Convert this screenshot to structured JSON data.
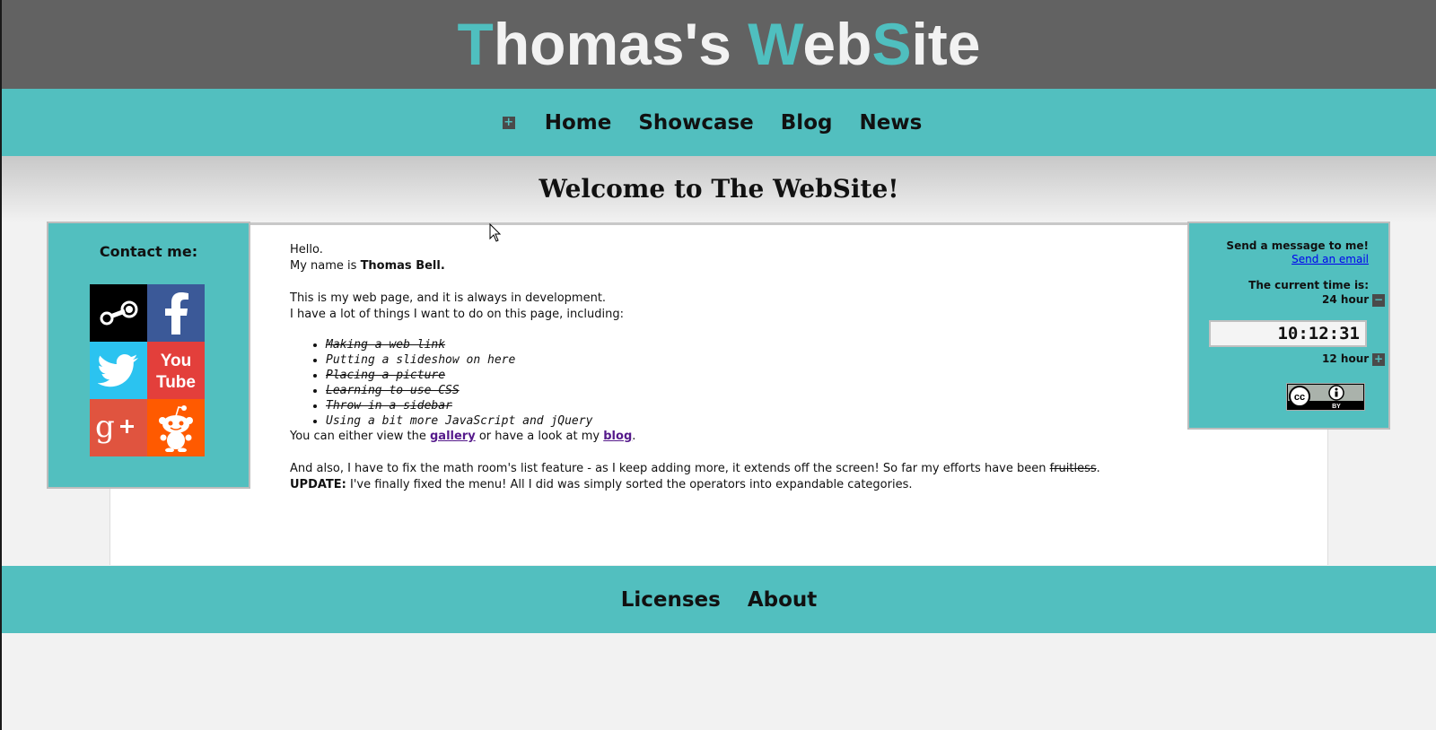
{
  "header": {
    "title_parts": [
      {
        "text": "T",
        "accent": true
      },
      {
        "text": "homas's ",
        "accent": false
      },
      {
        "text": "W",
        "accent": true
      },
      {
        "text": "eb",
        "accent": false
      },
      {
        "text": "S",
        "accent": true
      },
      {
        "text": "ite",
        "accent": false
      }
    ]
  },
  "nav": {
    "toggle_glyph": "+",
    "items": [
      "Home",
      "Showcase",
      "Blog",
      "News"
    ]
  },
  "welcome": {
    "title": "Welcome to The WebSite!"
  },
  "contact": {
    "title": "Contact me:",
    "icons": [
      "steam-icon",
      "facebook-icon",
      "twitter-icon",
      "youtube-icon",
      "google-plus-icon",
      "reddit-icon"
    ]
  },
  "content": {
    "hello": "Hello.",
    "name_prefix": "My name is ",
    "name": "Thomas Bell.",
    "intro1": "This is my web page, and it is always in development.",
    "intro2": "I have a lot of things I want to do on this page, including:",
    "todos": [
      {
        "text": "Making a web link",
        "done": true
      },
      {
        "text": "Putting a slideshow on here",
        "done": false
      },
      {
        "text": "Placing a picture",
        "done": true
      },
      {
        "text": "Learning to use CSS",
        "done": true
      },
      {
        "text": "Throw in a sidebar",
        "done": true
      },
      {
        "text": "Using a bit more JavaScript and jQuery",
        "done": false
      }
    ],
    "view_prefix": "You can either view the ",
    "gallery_link": "gallery",
    "view_middle": " or have a look at my ",
    "blog_link": "blog",
    "view_suffix": ".",
    "also_prefix": "And also, I have to fix the math room's list feature - as I keep adding more, it extends off the screen! So far my efforts have been ",
    "fruitless": "fruitless",
    "also_dot": ". ",
    "update_label": "UPDATE:",
    "update_text": " I've finally fixed the menu! All I did was simply sorted the operators into expandable categories."
  },
  "sidebar": {
    "message_title": "Send a message to me!",
    "email_link": "Send an email",
    "time_title": "The current time is:",
    "hour24_label": "24 hour",
    "hour24_button": "−",
    "clock": "10:12:31",
    "hour12_label": "12 hour",
    "hour12_button": "+",
    "license_badge": "BY"
  },
  "footer": {
    "items": [
      "Licenses",
      "About"
    ]
  },
  "colors": {
    "accent": "#4fbfbf",
    "header_bg": "#626262",
    "bar_bg": "#52bfbf"
  }
}
